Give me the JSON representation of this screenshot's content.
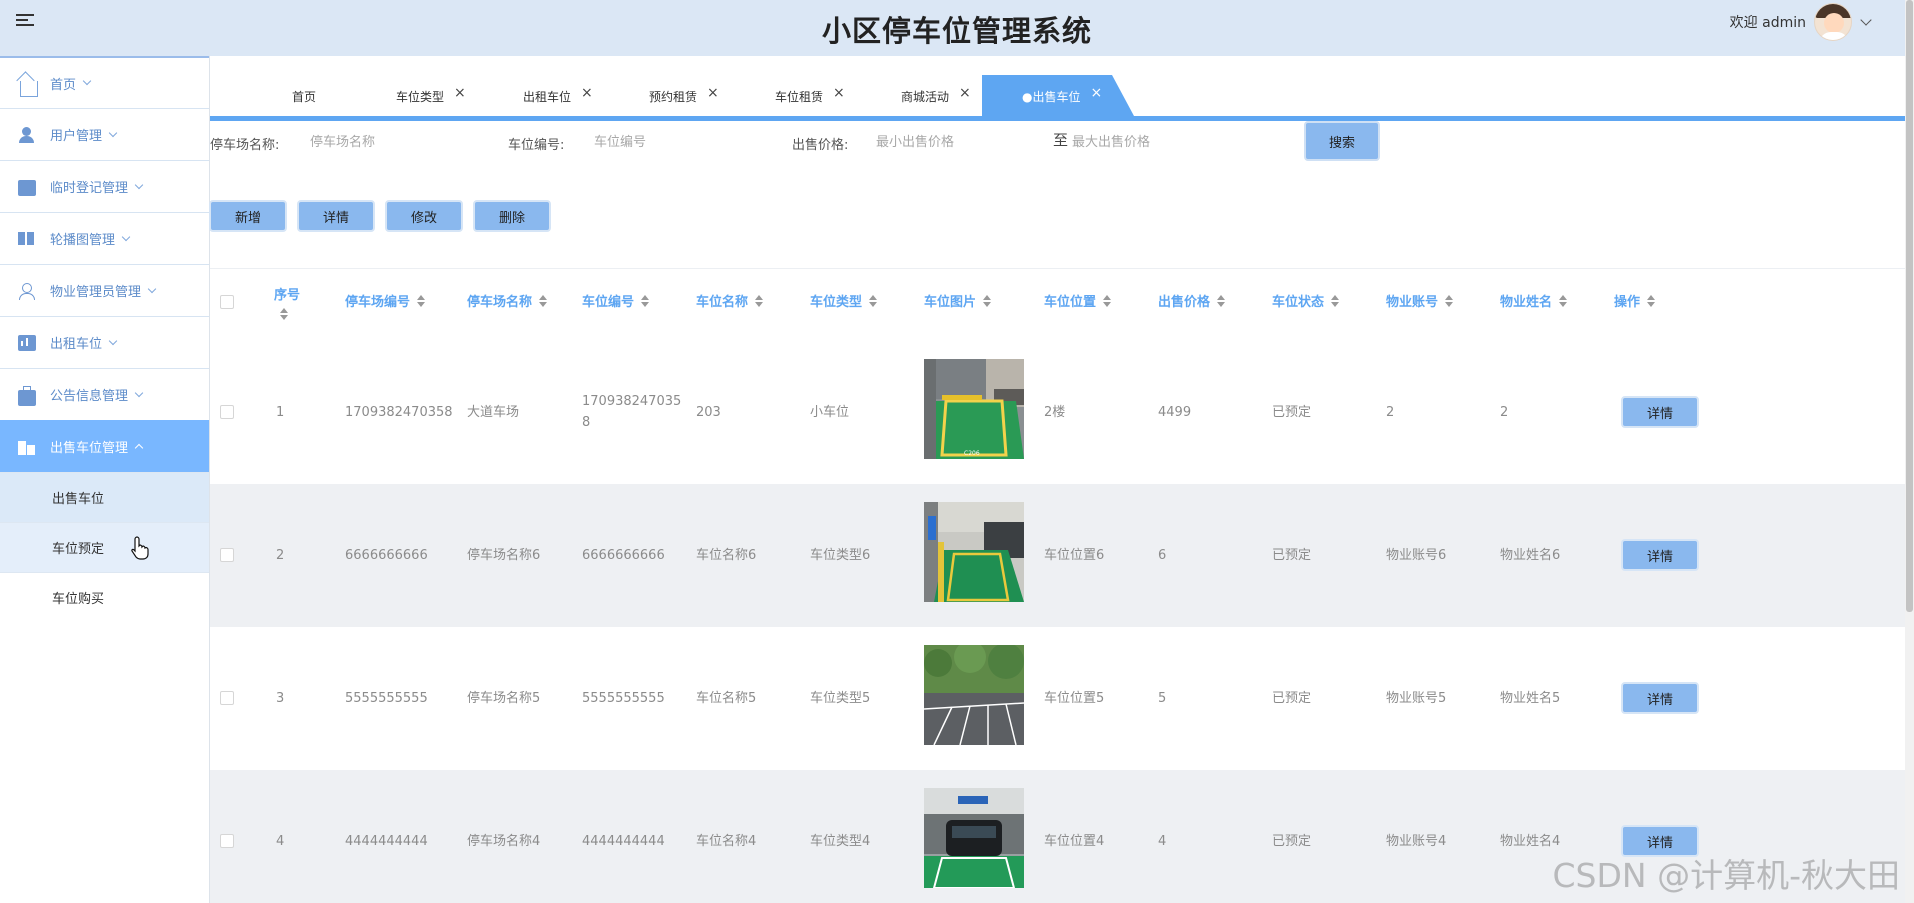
{
  "header": {
    "title": "小区停车位管理系统",
    "welcome": "欢迎 admin"
  },
  "sidebar": {
    "items": [
      {
        "label": "首页"
      },
      {
        "label": "用户管理"
      },
      {
        "label": "临时登记管理"
      },
      {
        "label": "轮播图管理"
      },
      {
        "label": "物业管理员管理"
      },
      {
        "label": "出租车位"
      },
      {
        "label": "公告信息管理"
      },
      {
        "label": "出售车位管理"
      }
    ],
    "subitems": [
      {
        "label": "出售车位"
      },
      {
        "label": "车位预定"
      },
      {
        "label": "车位购买"
      }
    ]
  },
  "tabs": [
    {
      "label": "首页"
    },
    {
      "label": "车位类型"
    },
    {
      "label": "出租车位"
    },
    {
      "label": "预约租赁"
    },
    {
      "label": "车位租赁"
    },
    {
      "label": "商城活动"
    },
    {
      "label": "●出售车位"
    }
  ],
  "tab_close": "×",
  "search": {
    "parking_name_label": "停车场名称:",
    "parking_name_placeholder": "停车场名称",
    "space_no_label": "车位编号:",
    "space_no_placeholder": "车位编号",
    "price_label": "出售价格:",
    "min_price_placeholder": "最小出售价格",
    "to_label": "至",
    "max_price_placeholder": "最大出售价格",
    "search_button": "搜索"
  },
  "actions": {
    "add": "新增",
    "detail": "详情",
    "edit": "修改",
    "delete": "删除"
  },
  "table": {
    "columns": [
      "序号",
      "停车场编号",
      "停车场名称",
      "车位编号",
      "车位名称",
      "车位类型",
      "车位图片",
      "车位位置",
      "出售价格",
      "车位状态",
      "物业账号",
      "物业姓名",
      "操作"
    ],
    "detail_button": "详情",
    "rows": [
      {
        "index": "1",
        "lot_no": "1709382470358",
        "lot_name": "大道车场",
        "space_no_line1": "170938247035",
        "space_no_line2": "8",
        "space_name": "203",
        "space_type": "小车位",
        "image": "green-parking-space-with-car",
        "location": "2楼",
        "price": "4499",
        "status": "已预定",
        "account": "2",
        "name": "2"
      },
      {
        "index": "2",
        "lot_no": "6666666666",
        "lot_name": "停车场名称6",
        "space_no_line1": "6666666666",
        "space_no_line2": "",
        "space_name": "车位名称6",
        "space_type": "车位类型6",
        "image": "underground-green-parking-space",
        "location": "车位位置6",
        "price": "6",
        "status": "已预定",
        "account": "物业账号6",
        "name": "物业姓名6"
      },
      {
        "index": "3",
        "lot_no": "5555555555",
        "lot_name": "停车场名称5",
        "space_no_line1": "5555555555",
        "space_no_line2": "",
        "space_name": "车位名称5",
        "space_type": "车位类型5",
        "image": "outdoor-parking-lot-with-trees",
        "location": "车位位置5",
        "price": "5",
        "status": "已预定",
        "account": "物业账号5",
        "name": "物业姓名5"
      },
      {
        "index": "4",
        "lot_no": "4444444444",
        "lot_name": "停车场名称4",
        "space_no_line1": "4444444444",
        "space_no_line2": "",
        "space_name": "车位名称4",
        "space_type": "车位类型4",
        "image": "underground-parked-car",
        "location": "车位位置4",
        "price": "4",
        "status": "已预定",
        "account": "物业账号4",
        "name": "物业姓名4"
      }
    ]
  },
  "watermark": "CSDN @计算机-秋大田",
  "colors": {
    "header_bg": "#dbe7f5",
    "accent": "#5ea6f2",
    "button": "#8ab8ee",
    "sidebar_active": "#79b7ff"
  }
}
